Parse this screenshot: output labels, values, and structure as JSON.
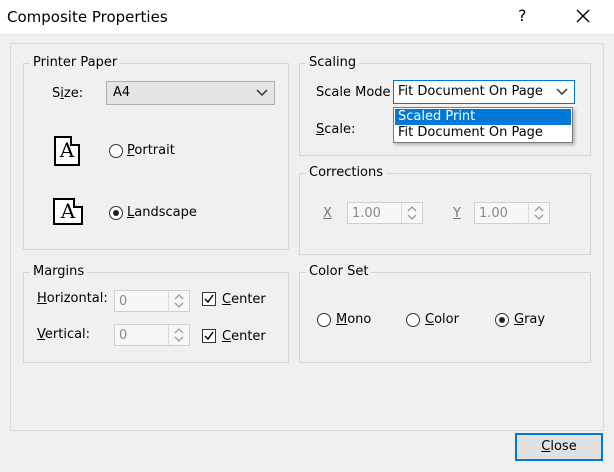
{
  "window": {
    "title": "Composite Properties",
    "help_label": "?"
  },
  "printer_paper": {
    "legend": "Printer Paper",
    "size_label_pre": "S",
    "size_label_u": "i",
    "size_label_post": "ze:",
    "size_value": "A4",
    "portrait_u": "P",
    "portrait_rest": "ortrait",
    "landscape_u": "L",
    "landscape_rest": "andscape",
    "paper_glyph": "A",
    "selected_orientation": "landscape"
  },
  "scaling": {
    "legend": "Scaling",
    "mode_label": "Scale Mode",
    "mode_value": "Fit Document On Page",
    "scale_u": "S",
    "scale_rest": "cale:",
    "options": [
      "Scaled Print",
      "Fit Document On Page"
    ],
    "highlighted_option": "Scaled Print"
  },
  "corrections": {
    "legend": "Corrections",
    "x_label": "X",
    "x_value": "1.00",
    "y_label": "Y",
    "y_value": "1.00"
  },
  "margins": {
    "legend": "Margins",
    "horizontal_u": "H",
    "horizontal_rest": "orizontal:",
    "horizontal_value": "0",
    "vertical_u": "V",
    "vertical_rest": "ertical:",
    "vertical_value": "0",
    "center_u": "C",
    "center_rest": "enter",
    "horizontal_center_checked": true,
    "vertical_center_checked": true
  },
  "color_set": {
    "legend": "Color Set",
    "mono_u": "M",
    "mono_rest": "ono",
    "color_u": "C",
    "color_rest": "olor",
    "gray_u": "G",
    "gray_rest": "ray",
    "selected": "gray"
  },
  "footer": {
    "close_u": "C",
    "close_rest": "lose"
  }
}
